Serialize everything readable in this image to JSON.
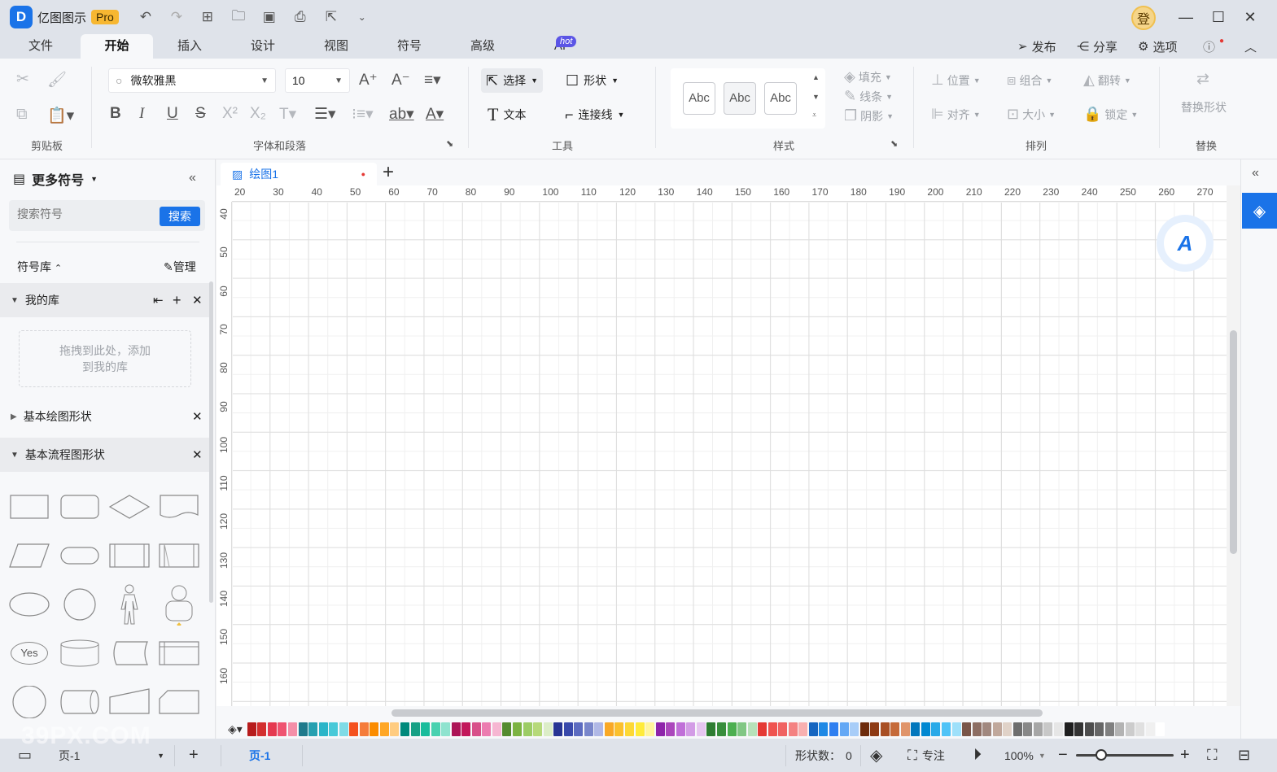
{
  "titlebar": {
    "app_name": "亿图图示",
    "pro_badge": "Pro",
    "user_avatar": "登"
  },
  "menu": {
    "tabs": [
      "文件",
      "开始",
      "插入",
      "设计",
      "视图",
      "符号",
      "高级",
      "AI"
    ],
    "active_tab": "开始",
    "ai_badge": "hot",
    "publish": "发布",
    "share": "分享",
    "options": "选项"
  },
  "ribbon": {
    "clipboard_label": "剪贴板",
    "font_label": "字体和段落",
    "font_family": "微软雅黑",
    "font_size": "10",
    "tools_label": "工具",
    "select": "选择",
    "shape": "形状",
    "text": "文本",
    "connector": "连接线",
    "style_label": "样式",
    "style_samples": [
      "Abc",
      "Abc",
      "Abc"
    ],
    "fill": "填充",
    "line": "线条",
    "shadow": "阴影",
    "arrange_label": "排列",
    "position": "位置",
    "group": "组合",
    "flip": "翻转",
    "align": "对齐",
    "size": "大小",
    "lock": "锁定",
    "replace_label": "替换",
    "replace_shape": "替换形状"
  },
  "leftpanel": {
    "title": "更多符号",
    "search_placeholder": "搜索符号",
    "search_button": "搜索",
    "library_label": "符号库",
    "manage": "管理",
    "my_library": "我的库",
    "drop_hint": "拖拽到此处，添加到我的库",
    "basic_shapes": "基本绘图形状",
    "flowchart_shapes": "基本流程图形状",
    "yes_label": "Yes"
  },
  "document": {
    "tab_title": "绘图1",
    "ruler_top": [
      "20",
      "30",
      "40",
      "50",
      "60",
      "70",
      "80",
      "90",
      "100",
      "110",
      "120",
      "130",
      "140",
      "150",
      "160",
      "170",
      "180",
      "190",
      "200",
      "210",
      "220",
      "230",
      "240",
      "250",
      "260",
      "270"
    ],
    "ruler_left": [
      "40",
      "50",
      "60",
      "70",
      "80",
      "90",
      "100",
      "110",
      "120",
      "130",
      "140",
      "150",
      "160"
    ]
  },
  "colors": {
    "accent": "#1a73e8",
    "palette": [
      "#b71c1c",
      "#d32f2f",
      "#e53950",
      "#ef5370",
      "#f48fa8",
      "#1f7a8c",
      "#26a0b0",
      "#2bb5c8",
      "#48c9d8",
      "#7fdbe6",
      "#f4511e",
      "#f57c3a",
      "#fb8c00",
      "#ffa726",
      "#ffcc80",
      "#00897b",
      "#16a085",
      "#1abc9c",
      "#48d1b0",
      "#8fe3cf",
      "#ad1457",
      "#c2185b",
      "#d8508a",
      "#ec7cb0",
      "#f6b6d2",
      "#558b2f",
      "#7cb342",
      "#9ccc65",
      "#b6d97a",
      "#dcedc8",
      "#283593",
      "#3949ab",
      "#5c6bc0",
      "#7986cb",
      "#b0b8e6",
      "#f9a825",
      "#fbc02d",
      "#fdd835",
      "#ffeb3b",
      "#fff59d",
      "#8e24aa",
      "#ab47bc",
      "#c06fd8",
      "#d39ce6",
      "#e6c6f0",
      "#2e7d32",
      "#388e3c",
      "#4caf50",
      "#81c784",
      "#b7e1b9",
      "#e53935",
      "#ef5350",
      "#f06262",
      "#f48181",
      "#f8b0b0",
      "#1565c0",
      "#1e88e5",
      "#2f7ff0",
      "#64a8f5",
      "#a8cdf8",
      "#6d2b0c",
      "#8d3a14",
      "#a84f24",
      "#c56a3a",
      "#e0946a",
      "#0277bd",
      "#0288d1",
      "#29a9e8",
      "#4fc3f7",
      "#9ee0fa",
      "#795548",
      "#8d6e63",
      "#a1887f",
      "#c0a89c",
      "#e0d2c8",
      "#6d6d6d",
      "#888888",
      "#a6a6a6",
      "#c8c8c8",
      "#e6e6e6",
      "#1f1f1f",
      "#333333",
      "#4d4d4d",
      "#666666",
      "#808080",
      "#b3b3b3",
      "#cccccc",
      "#e0e0e0",
      "#f0f0f0",
      "#ffffff"
    ]
  },
  "statusbar": {
    "page_selector": "页-1",
    "page_tab": "页-1",
    "shape_count_label": "形状数：",
    "shape_count": "0",
    "focus": "专注",
    "zoom": "100%"
  },
  "watermark": "39PX.COM"
}
